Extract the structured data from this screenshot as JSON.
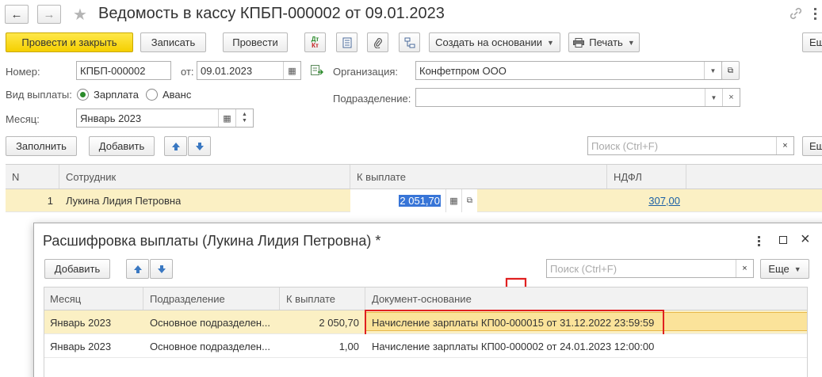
{
  "window": {
    "title": "Ведомость в кассу КПБП-000002 от 09.01.2023",
    "back_glyph": "←",
    "forward_glyph": "→",
    "star_glyph": "★"
  },
  "toolbar": {
    "post_close": "Провести и закрыть",
    "write": "Записать",
    "post": "Провести",
    "dt_kt_top": "Дт",
    "dt_kt_bottom": "Кт",
    "create_based": "Создать на основании",
    "print": "Печать",
    "more": "Ещ"
  },
  "form": {
    "number_label": "Номер:",
    "number_value": "КПБП-000002",
    "from_label": "от:",
    "date_value": "09.01.2023",
    "org_label": "Организация:",
    "org_value": "Конфетпром ООО",
    "pay_type_label": "Вид выплаты:",
    "pay_salary": "Зарплата",
    "pay_advance": "Аванс",
    "subdivision_label": "Подразделение:",
    "subdivision_value": "",
    "month_label": "Месяц:",
    "month_value": "Январь 2023"
  },
  "table_toolbar": {
    "fill": "Заполнить",
    "add": "Добавить",
    "search_placeholder": "Поиск (Ctrl+F)",
    "more": "Ещ"
  },
  "table": {
    "columns": [
      "N",
      "Сотрудник",
      "К выплате",
      "НДФЛ"
    ],
    "rows": [
      {
        "n": "1",
        "employee": "Лукина Лидия Петровна",
        "amount": "2 051,70",
        "ndfl": "307,00"
      }
    ]
  },
  "dialog": {
    "title": "Расшифровка выплаты (Лукина Лидия Петровна) *",
    "add": "Добавить",
    "search_placeholder": "Поиск (Ctrl+F)",
    "more": "Еще",
    "columns": [
      "Месяц",
      "Подразделение",
      "К выплате",
      "Документ-основание"
    ],
    "rows": [
      {
        "month": "Январь 2023",
        "subdivision": "Основное подразделен...",
        "amount": "2 050,70",
        "doc": "Начисление зарплаты КП00-000015 от 31.12.2022 23:59:59"
      },
      {
        "month": "Январь 2023",
        "subdivision": "Основное подразделен...",
        "amount": "1,00",
        "doc": "Начисление зарплаты КП00-000002 от 24.01.2023 12:00:00"
      }
    ]
  },
  "colors": {
    "primary_button": "#f5cf00",
    "selected_row": "#fbf0c4",
    "highlight_box": "#e02020",
    "link": "#1a5fa5"
  }
}
